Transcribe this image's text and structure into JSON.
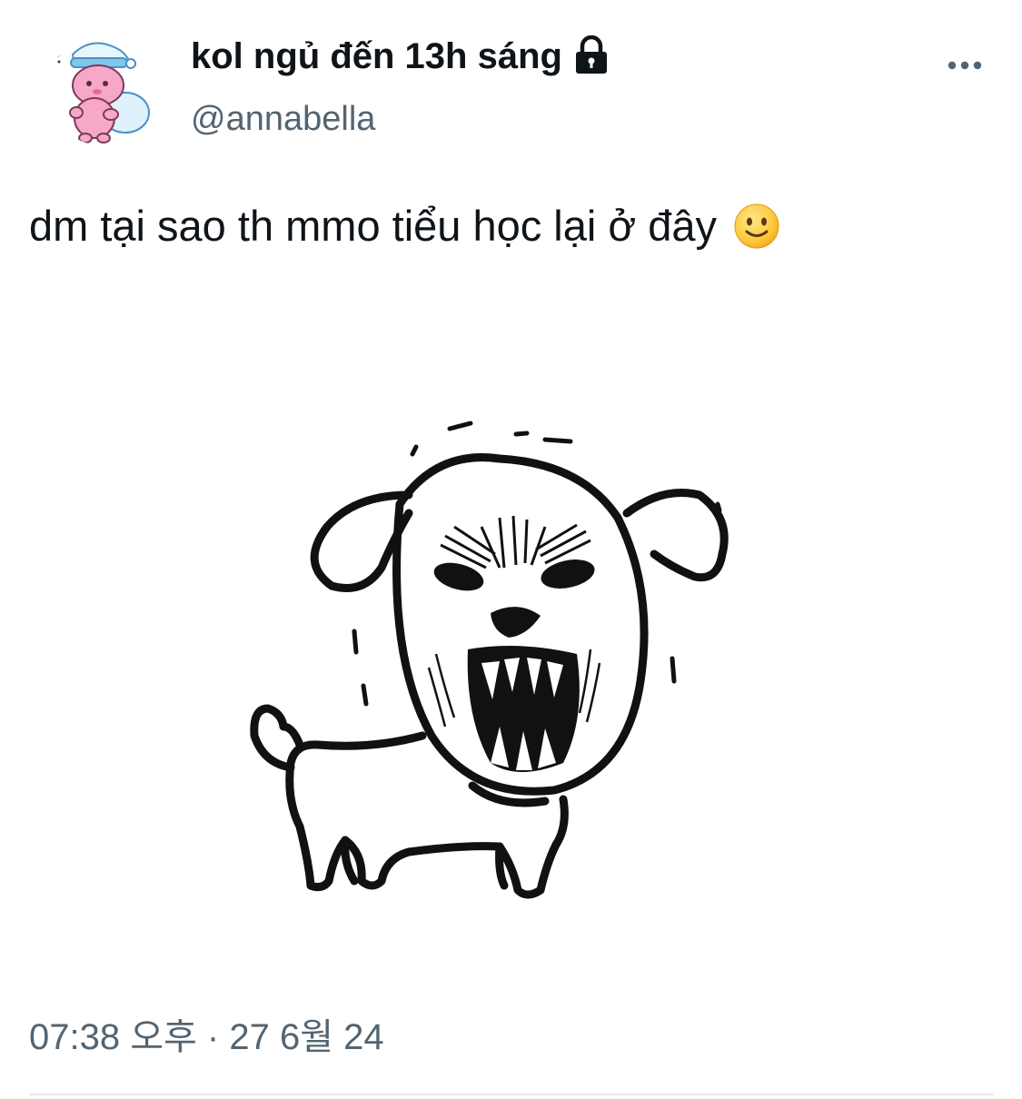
{
  "tweet": {
    "author": {
      "display_name": "kol ngủ đến 13h sáng",
      "handle": "@annabella",
      "protected_icon": "lock-icon",
      "avatar_icon": "pink-character-with-pillow-avatar"
    },
    "more_icon": "more-horizontal-icon",
    "text": "dm tại sao th mmo tiểu học lại ở đây",
    "text_emoji": "slightly-smiling-face-emoji",
    "media": {
      "type": "image",
      "description_icon": "angry-cartoon-dog-drawing"
    },
    "timestamp": "07:38 오후 · 27 6월 24"
  },
  "colors": {
    "text_primary": "#0f1419",
    "text_secondary": "#536471",
    "divider": "#e6e9ec"
  }
}
